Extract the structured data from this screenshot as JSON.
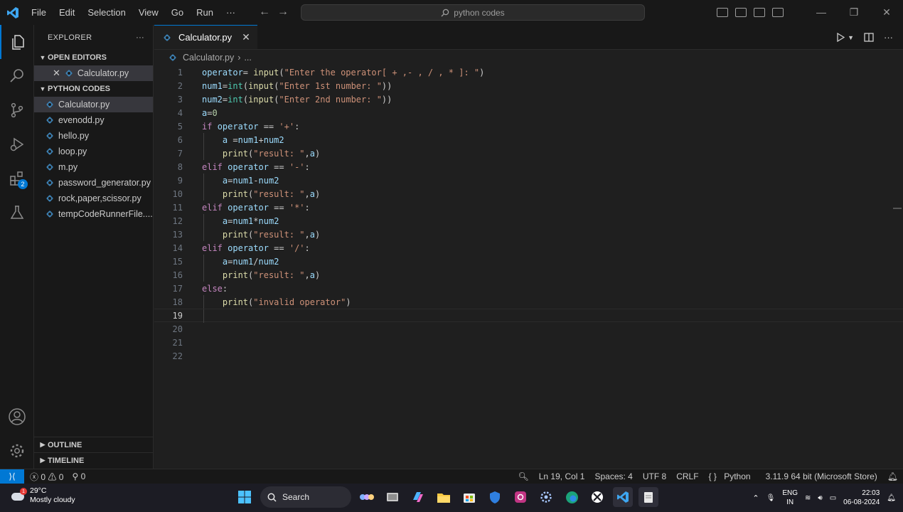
{
  "titlebar": {
    "menu": [
      "File",
      "Edit",
      "Selection",
      "View",
      "Go",
      "Run",
      "···"
    ],
    "search_text": "python codes"
  },
  "sidebar": {
    "title": "EXPLORER",
    "more": "···",
    "open_editors_label": "OPEN EDITORS",
    "open_editors": [
      {
        "name": "Calculator.py"
      }
    ],
    "folder_label": "PYTHON CODES",
    "files": [
      {
        "name": "Calculator.py"
      },
      {
        "name": "evenodd.py"
      },
      {
        "name": "hello.py"
      },
      {
        "name": "loop.py"
      },
      {
        "name": "m.py"
      },
      {
        "name": "password_generator.py"
      },
      {
        "name": "rock,paper,scissor.py"
      },
      {
        "name": "tempCodeRunnerFile...."
      }
    ],
    "outline_label": "OUTLINE",
    "timeline_label": "TIMELINE"
  },
  "activity": {
    "extensions_badge": "2"
  },
  "editor": {
    "tab_label": "Calculator.py",
    "breadcrumb_file": "Calculator.py",
    "breadcrumb_sep": "›",
    "breadcrumb_more": "...",
    "line_numbers": [
      "1",
      "2",
      "3",
      "4",
      "5",
      "6",
      "7",
      "8",
      "9",
      "10",
      "11",
      "12",
      "13",
      "14",
      "15",
      "16",
      "17",
      "18",
      "19",
      "20",
      "21",
      "22"
    ],
    "current_line": 19
  },
  "statusbar": {
    "errors": "0",
    "warnings": "0",
    "ports": "0",
    "position": "Ln 19, Col 1",
    "spaces": "Spaces: 4",
    "encoding": "UTF 8",
    "eol": "CRLF",
    "language": "Python",
    "interpreter": "3.11.9 64 bit (Microsoft Store)"
  },
  "taskbar": {
    "temp": "29°C",
    "condition": "Mostly cloudy",
    "weather_badge": "1",
    "search_label": "Search",
    "lang_top": "ENG",
    "lang_bottom": "IN",
    "time": "22:03",
    "date": "06-08-2024"
  },
  "colors": {
    "accent": "#0078d4",
    "keyword": "#c586c0",
    "function": "#dcdcaa",
    "variable": "#9cdcfe",
    "string": "#ce9178",
    "number": "#b5cea8"
  }
}
